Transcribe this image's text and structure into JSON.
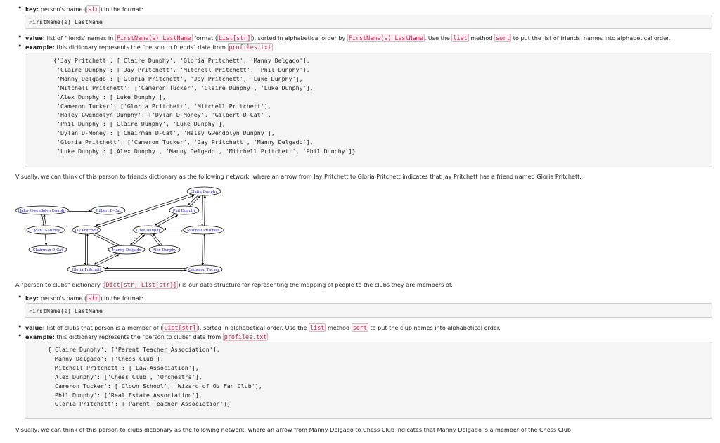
{
  "key1": {
    "prefix": "key:",
    "text_a": " person's name (",
    "code": "str",
    "text_b": ") in the format:",
    "format": "FirstName(s) LastName"
  },
  "value1": {
    "prefix": "value:",
    "t1": " list of friends' names in ",
    "c1": "FirstName(s) LastName",
    "t2": " format (",
    "c2": "List[str]",
    "t3": "), sorted in alphabetical order by ",
    "c3": "FirstName(s) LastName",
    "t4": ". Use the ",
    "c4": "list",
    "t5": " method ",
    "c5": "sort",
    "t6": " to put the list of friends' names into alphabetical order."
  },
  "example1": {
    "prefix": "example:",
    "t1": " this dictionary represents the \"person to friends\" data from ",
    "c1": "profiles.txt",
    "t2": ":",
    "code_lines": [
      "{'Jay Pritchett': ['Claire Dunphy', 'Gloria Pritchett', 'Manny Delgado'],",
      " 'Claire Dunphy': ['Jay Pritchett', 'Mitchell Pritchett', 'Phil Dunphy'],",
      " 'Manny Delgado': ['Gloria Pritchett', 'Jay Pritchett', 'Luke Dunphy'],",
      " 'Mitchell Pritchett': ['Cameron Tucker', 'Claire Dunphy', 'Luke Dunphy'],",
      " 'Alex Dunphy': ['Luke Dunphy'],",
      " 'Cameron Tucker': ['Gloria Pritchett', 'Mitchell Pritchett'],",
      " 'Haley Gwendolyn Dunphy': ['Dylan D-Money', 'Gilbert D-Cat'],",
      " 'Phil Dunphy': ['Claire Dunphy', 'Luke Dunphy'],",
      " 'Dylan D-Money': ['Chairman D-Cat', 'Haley Gwendolyn Dunphy'],",
      " 'Gloria Pritchett': ['Cameron Tucker', 'Jay Pritchett', 'Manny Delgado'],",
      " 'Luke Dunphy': ['Alex Dunphy', 'Manny Delgado', 'Mitchell Pritchett', 'Phil Dunphy']}"
    ]
  },
  "visual1": "Visually, we can think of this person to friends dictionary as the following network, where an arrow from Jay Pritchett to Gloria Pritchett indicates that Jay Pritchett has a friend named Gloria Pritchett.",
  "graph_nodes": {
    "claire": "Claire Dunphy",
    "haley": "Haley Gwendolyn Dunphy",
    "gilbert": "Gilbert D-Cat",
    "phil": "Phil Dunphy",
    "dylan": "Dylan D-Money",
    "jay": "Jay Pritchett",
    "luke": "Luke Dunphy",
    "mitchell": "Mitchell Pritchett",
    "chairman": "Chairman D-Cat",
    "manny": "Manny Delgado",
    "alex": "Alex Dunphy",
    "gloria": "Gloria Pritchett",
    "cameron": "Cameron Tucker"
  },
  "clubs_intro": {
    "t1": "A \"person to clubs\" dictionary (",
    "c1": "Dict[str, List[str]]",
    "t2": ") is our data structure for representing the mapping of people to the clubs they are members of."
  },
  "key2": {
    "prefix": "key:",
    "text_a": " person's name (",
    "code": "str",
    "text_b": ") in the format:",
    "format": "FirstName(s) LastName"
  },
  "value2": {
    "prefix": "value:",
    "t1": " list of clubs that person is a member of (",
    "c1": "List[str]",
    "t2": "), sorted in alphabetical order. Use the ",
    "c2": "list",
    "t3": " method ",
    "c3": "sort",
    "t4": " to put the club names into alphabetical order."
  },
  "example2": {
    "prefix": "example:",
    "t1": " this dictionary represents the \"person to clubs\" data from ",
    "c1": "profiles.txt",
    "code_lines": [
      "{'Claire Dunphy': ['Parent Teacher Association'],",
      " 'Manny Delgado': ['Chess Club'],",
      " 'Mitchell Pritchett': ['Law Association'],",
      " 'Alex Dunphy': ['Chess Club', 'Orchestra'],",
      " 'Cameron Tucker': ['Clown School', 'Wizard of Oz Fan Club'],",
      " 'Phil Dunphy': ['Real Estate Association'],",
      " 'Gloria Pritchett': ['Parent Teacher Association']}"
    ]
  },
  "visual2": "Visually, we can think of this person to clubs dictionary as the following network, where an arrow from Manny Delgado to Chess Club indicates that Manny Delgado is a member of the Chess Club."
}
